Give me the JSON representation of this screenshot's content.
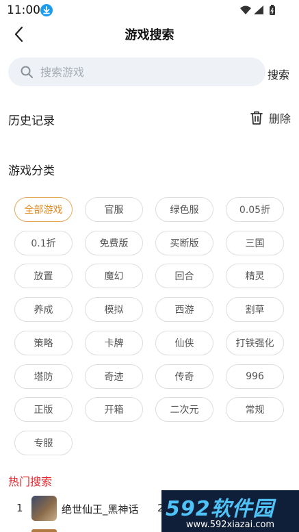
{
  "status_bar": {
    "time": "11:00"
  },
  "header": {
    "title": "游戏搜索"
  },
  "search": {
    "placeholder": "搜索游戏",
    "button_label": "搜索"
  },
  "history": {
    "title": "历史记录",
    "delete_label": "删除"
  },
  "categories": {
    "title": "游戏分类",
    "active_index": 0,
    "items": [
      "全部游戏",
      "官服",
      "绿色服",
      "0.05折",
      "0.1折",
      "免费版",
      "买断版",
      "三国",
      "放置",
      "魔幻",
      "回合",
      "精灵",
      "养成",
      "模拟",
      "西游",
      "割草",
      "策略",
      "卡牌",
      "仙侠",
      "打铁强化",
      "塔防",
      "奇迹",
      "传奇",
      "996",
      "正版",
      "开箱",
      "二次元",
      "常规",
      "专服"
    ]
  },
  "hot_search": {
    "title": "热门搜索",
    "items": [
      {
        "rank": "1",
        "name": "绝世仙王_黑神话",
        "extra": "2"
      }
    ]
  },
  "watermark": {
    "logo": "592软件园",
    "url": "www.592xiazai.com"
  },
  "colors": {
    "accent": "#e08a24",
    "hot_red": "#e8232a",
    "search_bg": "#eef1f6"
  }
}
